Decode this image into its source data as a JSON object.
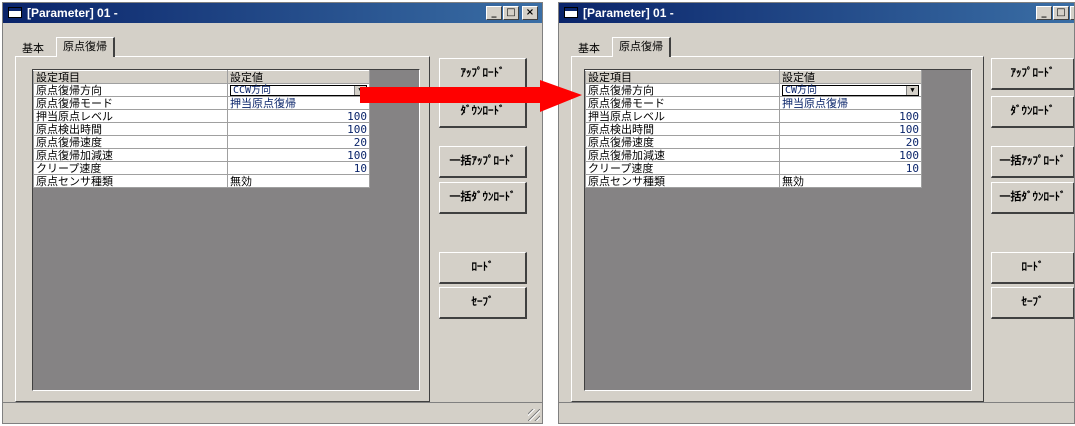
{
  "left_window": {
    "title": "[Parameter] 01 -",
    "controls": [
      "_",
      "□",
      "×"
    ],
    "tabs": [
      "基本",
      "原点復帰"
    ],
    "grid": {
      "headers": [
        "設定項目",
        "設定値"
      ],
      "direction": {
        "label": "原点復帰方向",
        "value": "CCW方向"
      },
      "rows": [
        {
          "label": "原点復帰モード",
          "value": "押当原点復帰"
        },
        {
          "label": "押当原点レベル",
          "value": "100"
        },
        {
          "label": "原点検出時間",
          "value": "100"
        },
        {
          "label": "原点復帰速度",
          "value": "20"
        },
        {
          "label": "原点復帰加減速",
          "value": "100"
        },
        {
          "label": "クリープ速度",
          "value": "10"
        },
        {
          "label": "原点センサ種類",
          "value": "無効"
        }
      ]
    },
    "buttons": [
      "ｱｯﾌﾟﾛｰﾄﾞ",
      "ﾀﾞｳﾝﾛｰﾄﾞ",
      "一括ｱｯﾌﾟﾛｰﾄﾞ",
      "一括ﾀﾞｳﾝﾛｰﾄﾞ",
      "ﾛｰﾄﾞ",
      "ｾｰﾌﾞ"
    ]
  },
  "right_window": {
    "title": "[Parameter] 01 -",
    "controls": [
      "_",
      "□",
      "×"
    ],
    "tabs": [
      "基本",
      "原点復帰"
    ],
    "grid": {
      "headers": [
        "設定項目",
        "設定値"
      ],
      "direction": {
        "label": "原点復帰方向",
        "value": "CW方向"
      },
      "rows": [
        {
          "label": "原点復帰モード",
          "value": "押当原点復帰"
        },
        {
          "label": "押当原点レベル",
          "value": "100"
        },
        {
          "label": "原点検出時間",
          "value": "100"
        },
        {
          "label": "原点復帰速度",
          "value": "20"
        },
        {
          "label": "原点復帰加減速",
          "value": "100"
        },
        {
          "label": "クリープ速度",
          "value": "10"
        },
        {
          "label": "原点センサ種類",
          "value": "無効"
        }
      ]
    },
    "buttons": [
      "ｱｯﾌﾟﾛｰﾄﾞ",
      "ﾀﾞｳﾝﾛｰﾄﾞ",
      "一括ｱｯﾌﾟﾛｰﾄﾞ",
      "一括ﾀﾞｳﾝﾛｰﾄﾞ",
      "ﾛｰﾄﾞ",
      "ｾｰﾌﾞ"
    ]
  },
  "colors": {
    "title_bar": "#0a246a",
    "grid_background": "#858384",
    "value_text": "#0a246a",
    "arrow": "#ff0000",
    "window_face": "#d4d0c8"
  },
  "annotation_icon": "red-arrow-icon"
}
